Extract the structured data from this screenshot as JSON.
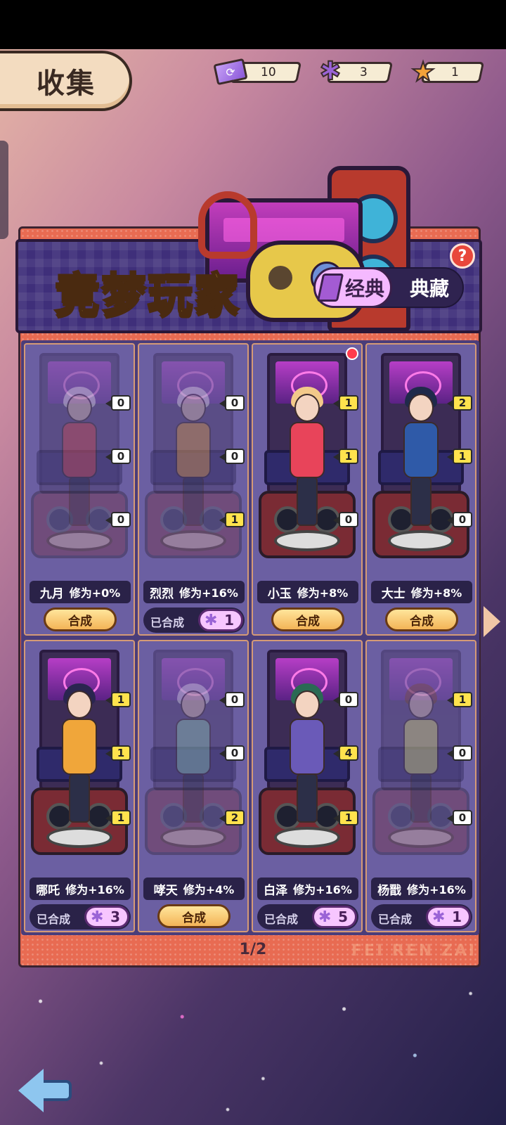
{
  "header": {
    "title": "收集",
    "resources": [
      {
        "icon": "ticket-icon",
        "value": "10"
      },
      {
        "icon": "puzzle-icon",
        "value": "3"
      },
      {
        "icon": "star-icon",
        "value": "1"
      }
    ]
  },
  "banner": {
    "title": "竞梦玩家",
    "tabs": [
      {
        "label": "经典",
        "active": true
      },
      {
        "label": "典藏",
        "active": false
      }
    ],
    "help": "?"
  },
  "cards": [
    {
      "name": "九月",
      "bonus": "修为+0%",
      "badges": [
        "0",
        "0",
        "0"
      ],
      "action": "合成",
      "done": false,
      "count": ""
    },
    {
      "name": "烈烈",
      "bonus": "修为+16%",
      "badges": [
        "0",
        "0",
        "1"
      ],
      "action": "已合成",
      "done": true,
      "count": "1"
    },
    {
      "name": "小玉",
      "bonus": "修为+8%",
      "badges": [
        "1",
        "1",
        "0"
      ],
      "action": "合成",
      "done": false,
      "count": "",
      "dot": true
    },
    {
      "name": "大士",
      "bonus": "修为+8%",
      "badges": [
        "2",
        "1",
        "0"
      ],
      "action": "合成",
      "done": false,
      "count": ""
    },
    {
      "name": "哪吒",
      "bonus": "修为+16%",
      "badges": [
        "1",
        "1",
        "1"
      ],
      "action": "已合成",
      "done": true,
      "count": "3"
    },
    {
      "name": "哮天",
      "bonus": "修为+4%",
      "badges": [
        "0",
        "0",
        "2"
      ],
      "action": "合成",
      "done": false,
      "count": ""
    },
    {
      "name": "白泽",
      "bonus": "修为+16%",
      "badges": [
        "0",
        "4",
        "1"
      ],
      "action": "已合成",
      "done": true,
      "count": "5"
    },
    {
      "name": "杨戬",
      "bonus": "修为+16%",
      "badges": [
        "1",
        "0",
        "0"
      ],
      "action": "已合成",
      "done": true,
      "count": "1"
    }
  ],
  "pagination": {
    "current": "1/2"
  },
  "watermark": "FEI REN ZAI",
  "colors": {
    "accent": "#f3b457",
    "panel": "#e86b52",
    "card_bg": "#6b5fa2",
    "badge_positive": "#ffe34d"
  }
}
